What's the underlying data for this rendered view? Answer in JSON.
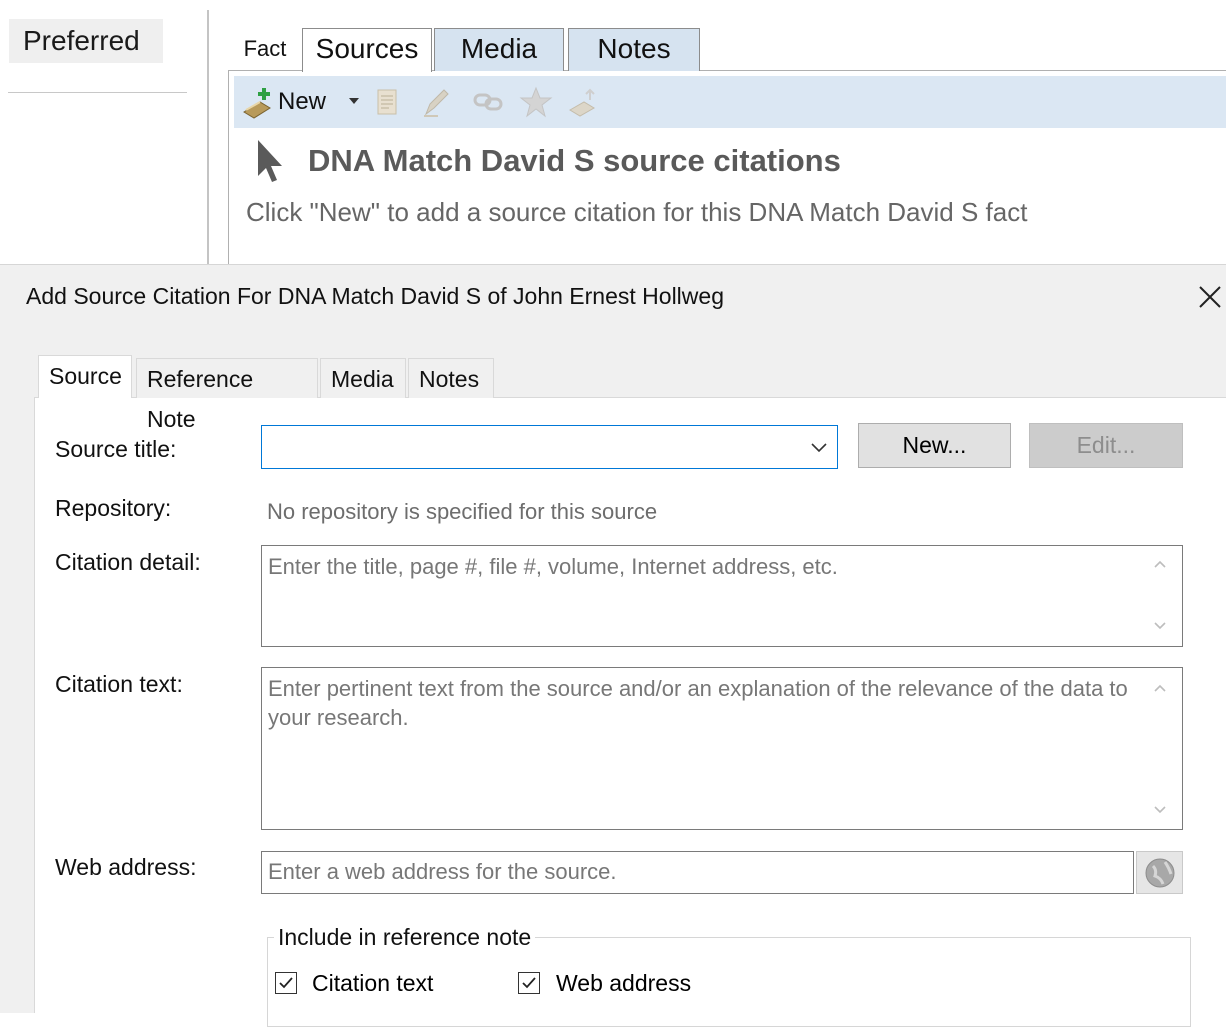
{
  "top_panel": {
    "preferred_label": "Preferred",
    "tabs": [
      "Fact",
      "Sources",
      "Media",
      "Notes"
    ],
    "toolbar": {
      "new_label": "New"
    },
    "headline": "DNA Match David S source citations",
    "hint": "Click \"New\" to add a source citation for this DNA Match David S fact"
  },
  "dialog": {
    "title": "Add Source Citation For DNA Match David S of John Ernest Hollweg",
    "close_glyph": "×",
    "tabs": [
      "Source",
      "Reference Note",
      "Media",
      "Notes"
    ],
    "labels": {
      "source_title": "Source title:",
      "repository": "Repository:",
      "citation_detail": "Citation detail:",
      "citation_text": "Citation text:",
      "web_address": "Web address:"
    },
    "source_title_value": "",
    "repository_value": "No repository is specified for this source",
    "citation_detail_placeholder": "Enter the title, page #, file #, volume, Internet address, etc.",
    "citation_text_placeholder": "Enter pertinent text from the source and/or an explanation of the relevance of the data to your research.",
    "web_address_placeholder": "Enter a web address for the source.",
    "buttons": {
      "new": "New...",
      "edit": "Edit..."
    },
    "include_group": {
      "label": "Include in reference note",
      "citation_text": "Citation text",
      "web_address": "Web address",
      "citation_text_checked": true,
      "web_address_checked": true
    }
  },
  "icons": [
    "cursor-arrow-icon",
    "new-citation-icon",
    "dropdown-arrow-icon",
    "copy-icon",
    "edit-pencil-icon",
    "link-icon",
    "star-icon",
    "sign-icon",
    "chevron-down-icon",
    "scroll-up-icon",
    "scroll-down-icon",
    "globe-icon",
    "close-icon",
    "checkmark-icon"
  ]
}
